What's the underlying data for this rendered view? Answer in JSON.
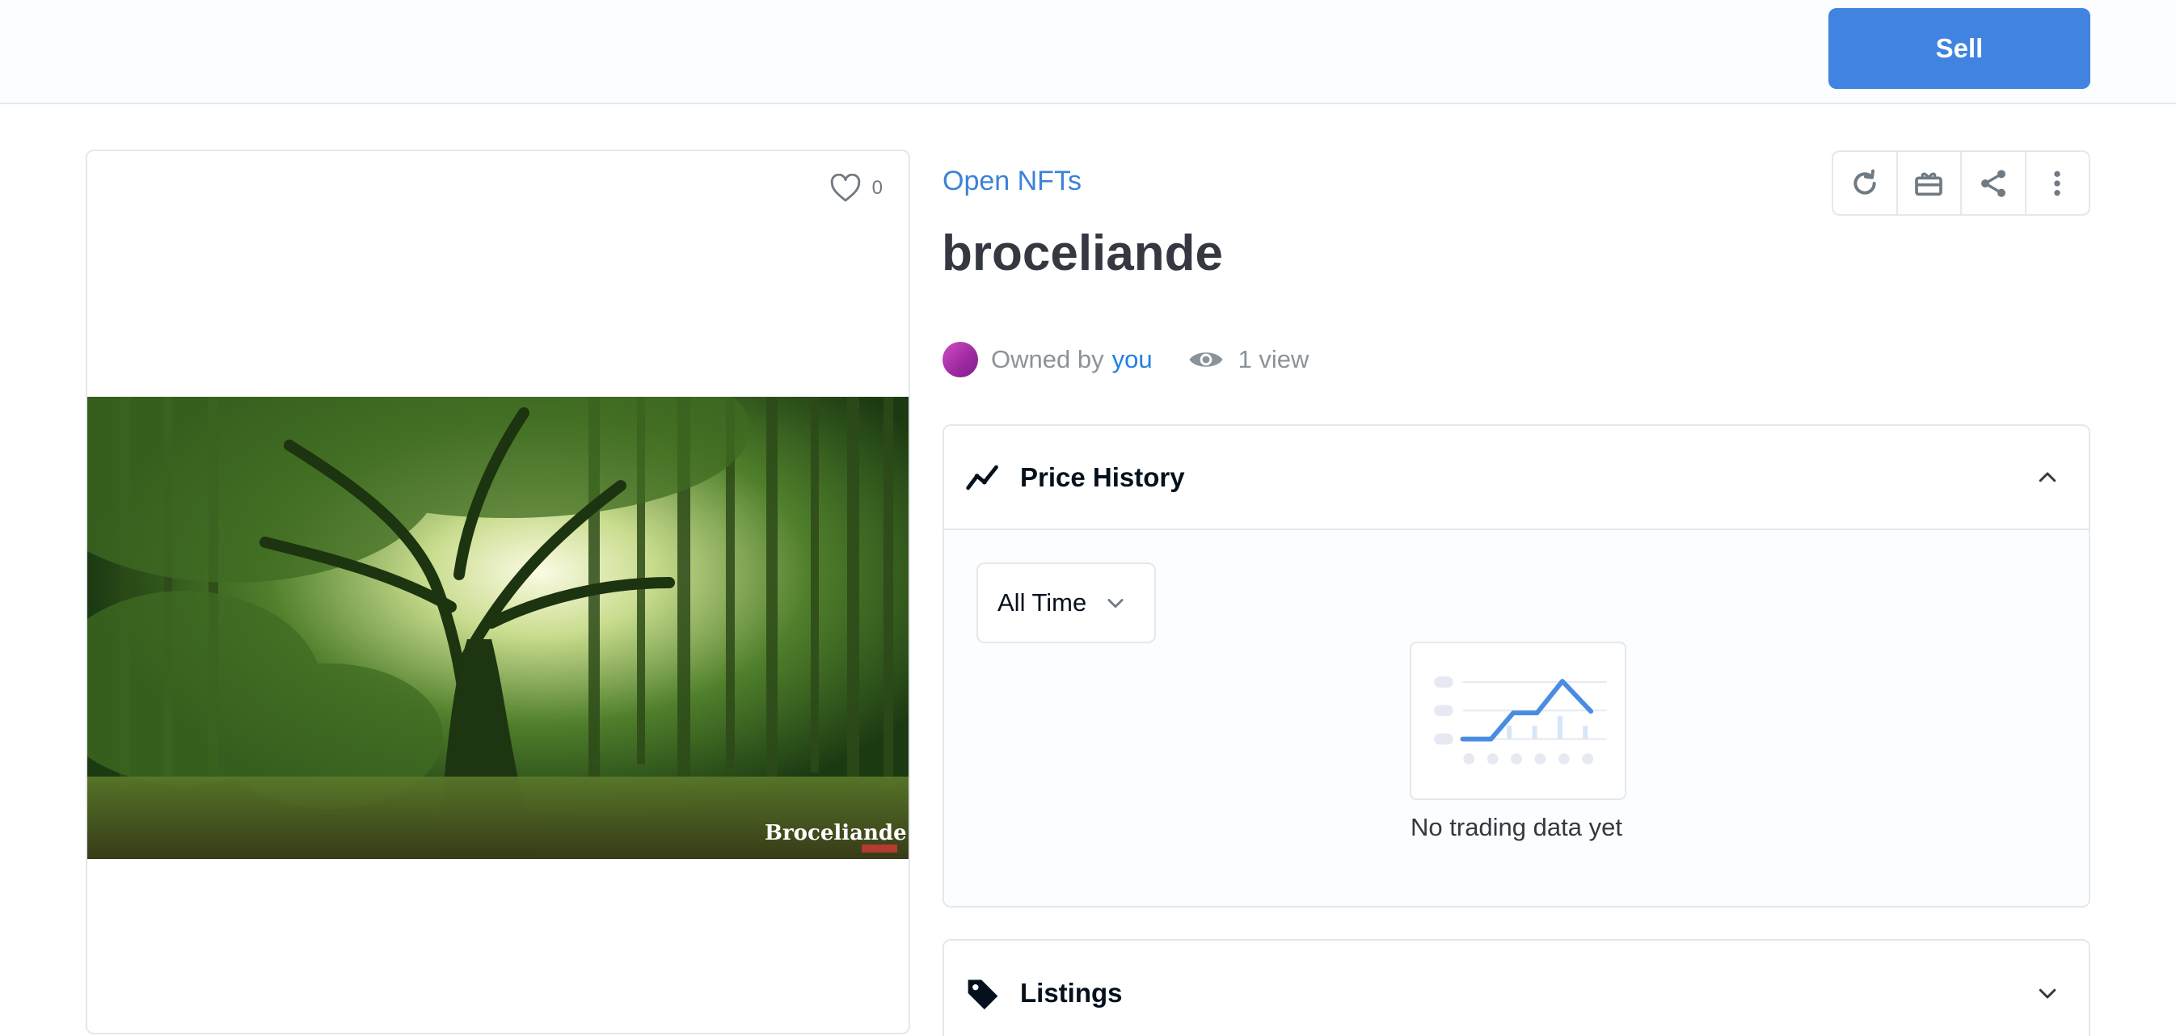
{
  "header": {
    "sell_label": "Sell"
  },
  "asset": {
    "favorites_count": "0",
    "collection": "Open NFTs",
    "title": "broceliande",
    "owned_by_prefix": "Owned by",
    "owner": "you",
    "views": "1 view",
    "image_watermark": "Broceliande"
  },
  "price_history": {
    "title": "Price History",
    "range_selected": "All Time",
    "empty_text": "No trading data yet"
  },
  "listings": {
    "title": "Listings"
  },
  "colors": {
    "accent": "#4183e0",
    "link": "#2081e2",
    "border": "#e5e8eb"
  }
}
